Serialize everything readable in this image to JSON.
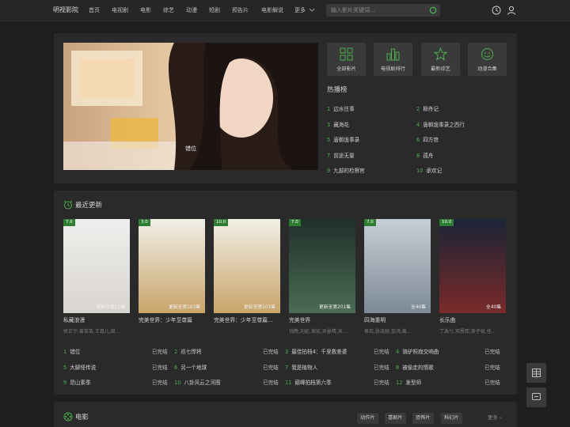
{
  "site": {
    "logo": "明视影院"
  },
  "nav": {
    "items": [
      "首页",
      "电视剧",
      "电影",
      "综艺",
      "动漫",
      "短剧",
      "预告片",
      "电影解说",
      "更多"
    ]
  },
  "search": {
    "placeholder": "输入影片关键词..."
  },
  "banner": {
    "caption": "错位"
  },
  "quick_links": [
    {
      "label": "全部影片",
      "icon": "grid-icon"
    },
    {
      "label": "电视剧排行",
      "icon": "bar-chart-icon"
    },
    {
      "label": "最新综艺",
      "icon": "star-icon"
    },
    {
      "label": "动漫合集",
      "icon": "smiley-icon"
    }
  ],
  "hot": {
    "title": "热播榜",
    "items": [
      {
        "num": "1",
        "title": "边水往事"
      },
      {
        "num": "2",
        "title": "柳舟记"
      },
      {
        "num": "3",
        "title": "藏海花"
      },
      {
        "num": "4",
        "title": "唐朝诡事录之西行"
      },
      {
        "num": "5",
        "title": "唐朝诡事录"
      },
      {
        "num": "6",
        "title": "四方馆"
      },
      {
        "num": "7",
        "title": "前途无量"
      },
      {
        "num": "8",
        "title": "孤舟"
      },
      {
        "num": "9",
        "title": "九部的检察官"
      },
      {
        "num": "10",
        "title": "承欢记"
      }
    ]
  },
  "recent": {
    "title": "最近更新",
    "posters": [
      {
        "score": "7.0",
        "status": "更新至第11集",
        "title": "私藏浪漫",
        "cast": "徐正宁,曾苗苗,王真儿,周...",
        "colors": [
          "#efefed",
          "#d8d4d0"
        ]
      },
      {
        "score": "3.0",
        "status": "更新至第103集",
        "title": "完美世界：少年至尊篇",
        "cast": "",
        "colors": [
          "#f1efe8",
          "#c9a56a"
        ]
      },
      {
        "score": "10.0",
        "status": "更新至第101集",
        "title": "完美世界：少年至尊篇...",
        "cast": "",
        "colors": [
          "#f2efe6",
          "#c8a46a"
        ]
      },
      {
        "score": "7.0",
        "status": "更新至第201集",
        "title": "完美世界",
        "cast": "钱晚,刘延,谢宏,吴曼晴,吴...",
        "colors": [
          "#20302a",
          "#4a6b54"
        ]
      },
      {
        "score": "7.0",
        "status": "全40集",
        "title": "四海重明",
        "cast": "章若,张凌赫,宣鸿,黄...",
        "colors": [
          "#c8cfd6",
          "#7d8a96"
        ]
      },
      {
        "score": "10.0",
        "status": "全40集",
        "title": "长乐曲",
        "cast": "丁禹兮,邓恩熙,茶子俊,任...",
        "colors": [
          "#1b2436",
          "#7a2a2a"
        ]
      }
    ],
    "list": [
      {
        "num": "1",
        "title": "错位",
        "status": "已完结"
      },
      {
        "num": "2",
        "title": "巡七悍将",
        "status": "已完结"
      },
      {
        "num": "3",
        "title": "最佳拍档4：千里救差婆",
        "status": "已完结"
      },
      {
        "num": "4",
        "title": "骑驴照寂交响曲",
        "status": "已完结"
      },
      {
        "num": "5",
        "title": "大脚怪传说",
        "status": "已完结"
      },
      {
        "num": "6",
        "title": "另一个地球",
        "status": "已完结"
      },
      {
        "num": "7",
        "title": "我是植物人",
        "status": "已完结"
      },
      {
        "num": "8",
        "title": "被偷走的情歌",
        "status": "已完结"
      },
      {
        "num": "9",
        "title": "昂山素季",
        "status": "已完结"
      },
      {
        "num": "10",
        "title": "八卦风云之河图",
        "status": "已完结"
      },
      {
        "num": "11",
        "title": "巅峰拍档第六季",
        "status": "已完结"
      },
      {
        "num": "12",
        "title": "发型师",
        "status": "已完结"
      }
    ]
  },
  "movie": {
    "title": "电影",
    "tags": [
      "动作片",
      "喜剧片",
      "恐怖片",
      "科幻片"
    ],
    "more": "更多"
  },
  "colors": {
    "accent": "#4caf50",
    "background": "#1e1e1e",
    "panel": "#2a2a2a",
    "tile": "#3a3a3a"
  }
}
